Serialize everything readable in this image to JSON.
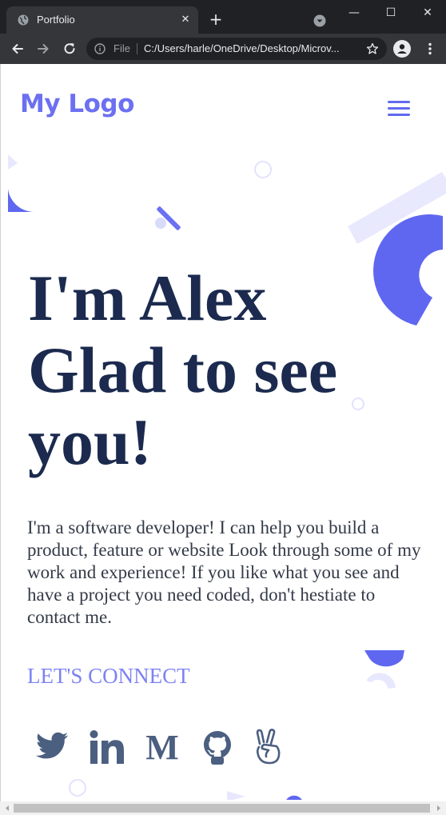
{
  "browser": {
    "tab_title": "Portfolio",
    "tab_close": "✕",
    "new_tab": "+",
    "scheme_label": "File",
    "url": "C:/Users/harle/OneDrive/Desktop/Microv...",
    "icons": [
      "globe-icon",
      "close-icon",
      "plus-icon",
      "chevron-down-icon",
      "minimize-icon",
      "maximize-icon",
      "close-window-icon",
      "back-icon",
      "forward-icon",
      "reload-icon",
      "info-icon",
      "star-icon",
      "profile-icon",
      "more-icon"
    ],
    "window_controls": {
      "minimize": "—",
      "maximize": "☐",
      "close": "✕"
    }
  },
  "site": {
    "logo": "My Logo",
    "hero_lines": [
      "I'm Alex",
      "Glad to see",
      "you!"
    ],
    "intro": "I'm a software developer! I can help you build a product, feature or website Look through some of my work and experience! If you like what you see and have a project you need coded, don't hestiate to contact me.",
    "connect": "LET'S CONNECT",
    "social_icons": [
      "twitter-icon",
      "linkedin-icon",
      "medium-icon",
      "github-icon",
      "angellist-icon"
    ],
    "medium_glyph": "M"
  },
  "colors": {
    "brand": "#6c70f0",
    "heading": "#1b2a4e",
    "body_text": "#333a48",
    "connect": "#7d82f2",
    "social": "#4b5f80",
    "chrome_dark": "#202124",
    "chrome_toolbar": "#35363a"
  }
}
